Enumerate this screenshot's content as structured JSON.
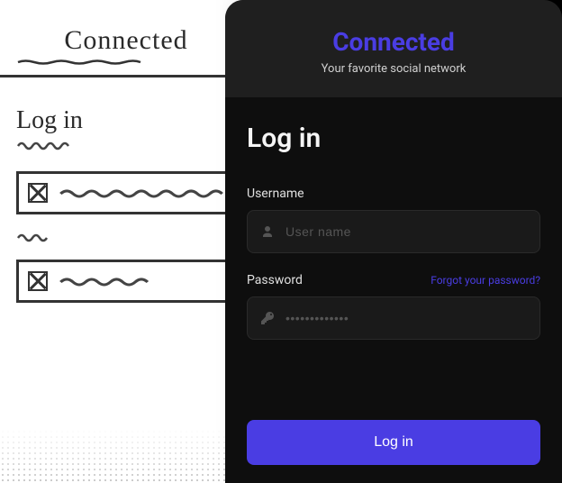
{
  "sketch": {
    "title": "Connected",
    "login_heading": "Log in"
  },
  "app": {
    "brand": "Connected",
    "tagline": "Your favorite social network",
    "heading": "Log in",
    "username": {
      "label": "Username",
      "placeholder": "User name"
    },
    "password": {
      "label": "Password",
      "placeholder": "•••••••••••••",
      "forgot": "Forgot your password?"
    },
    "login_button": "Log in",
    "colors": {
      "accent": "#4a3de3",
      "bg_dark": "#0e0e0e",
      "bg_header": "#1f1f1f",
      "input_bg": "#1a1a1a"
    }
  }
}
